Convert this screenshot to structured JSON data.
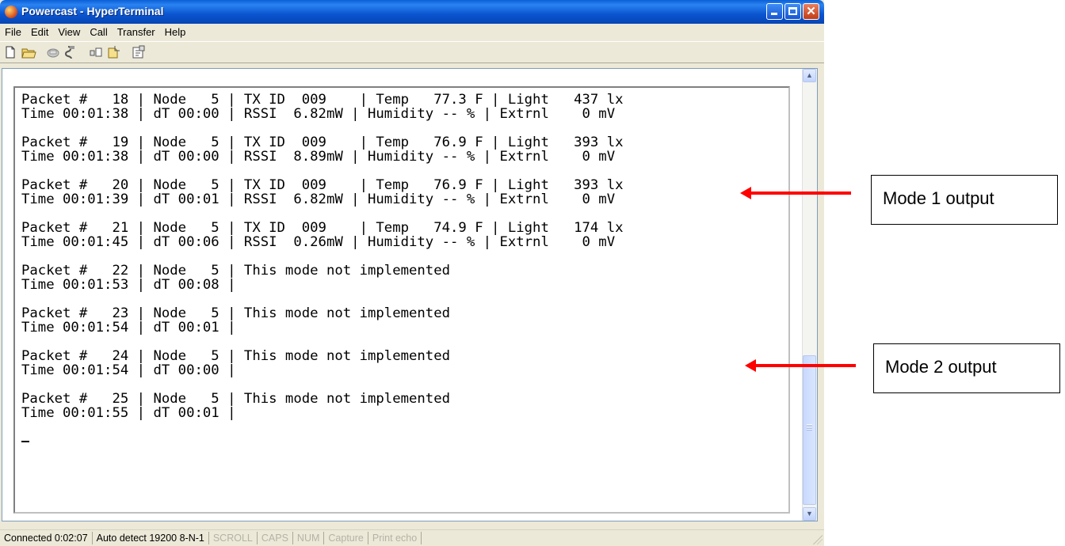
{
  "window": {
    "title": "Powercast - HyperTerminal"
  },
  "menu": [
    "File",
    "Edit",
    "View",
    "Call",
    "Transfer",
    "Help"
  ],
  "toolbar_icons": [
    "new-icon",
    "open-icon",
    "phone-icon",
    "disconnect-icon",
    "send-icon",
    "receive-icon",
    "properties-icon"
  ],
  "terminal": {
    "lines": [
      "Packet #   18 | Node   5 | TX ID  009    | Temp   77.3 F | Light   437 lx",
      "Time 00:01:38 | dT 00:00 | RSSI  6.82mW | Humidity -- % | Extrnl    0 mV",
      "",
      "Packet #   19 | Node   5 | TX ID  009    | Temp   76.9 F | Light   393 lx",
      "Time 00:01:38 | dT 00:00 | RSSI  8.89mW | Humidity -- % | Extrnl    0 mV",
      "",
      "Packet #   20 | Node   5 | TX ID  009    | Temp   76.9 F | Light   393 lx",
      "Time 00:01:39 | dT 00:01 | RSSI  6.82mW | Humidity -- % | Extrnl    0 mV",
      "",
      "Packet #   21 | Node   5 | TX ID  009    | Temp   74.9 F | Light   174 lx",
      "Time 00:01:45 | dT 00:06 | RSSI  0.26mW | Humidity -- % | Extrnl    0 mV",
      "",
      "Packet #   22 | Node   5 | This mode not implemented",
      "Time 00:01:53 | dT 00:08 |",
      "",
      "Packet #   23 | Node   5 | This mode not implemented",
      "Time 00:01:54 | dT 00:01 |",
      "",
      "Packet #   24 | Node   5 | This mode not implemented",
      "Time 00:01:54 | dT 00:00 |",
      "",
      "Packet #   25 | Node   5 | This mode not implemented",
      "Time 00:01:55 | dT 00:01 |"
    ]
  },
  "status": {
    "connected": "Connected 0:02:07",
    "detect": "Auto detect 19200 8-N-1",
    "scroll": "SCROLL",
    "caps": "CAPS",
    "num": "NUM",
    "capture": "Capture",
    "print_echo": "Print echo"
  },
  "annotations": {
    "mode1": "Mode 1 output",
    "mode2": "Mode 2 output",
    "arrow_color": "#ff0000"
  }
}
